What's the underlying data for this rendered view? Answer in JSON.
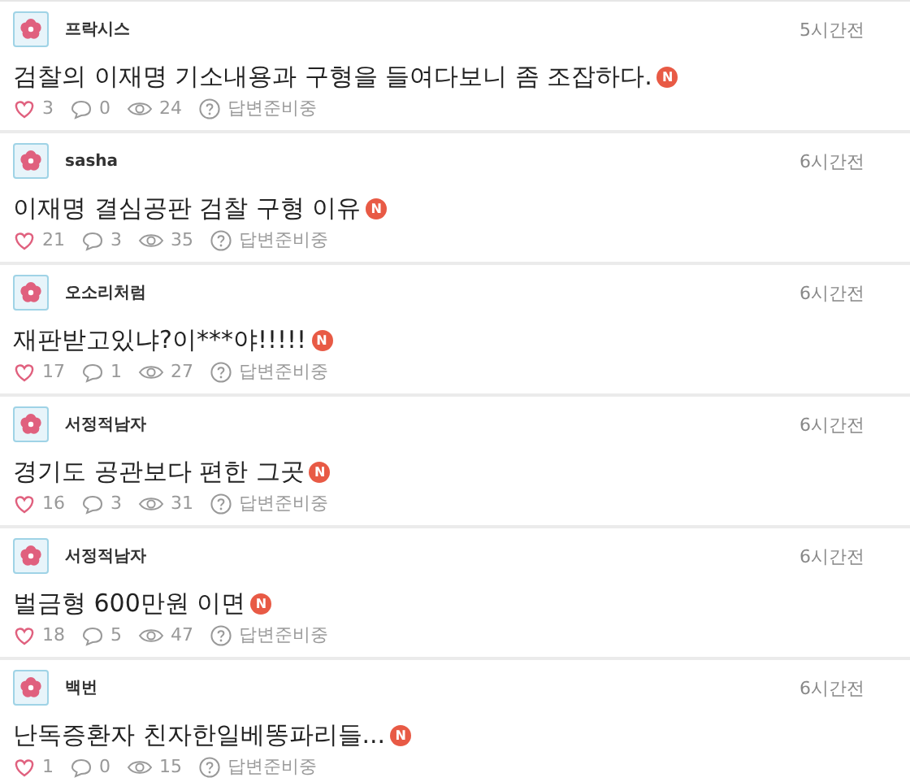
{
  "posts": [
    {
      "author": "프락시스",
      "time": "5시간전",
      "title": "검찰의 이재명 기소내용과 구형을 들여다보니 좀 조잡하다.",
      "badge": "N",
      "likes": "3",
      "comments": "0",
      "views": "24",
      "status": "답변준비중"
    },
    {
      "author": "sasha",
      "time": "6시간전",
      "title": "이재명 결심공판 검찰 구형 이유",
      "badge": "N",
      "likes": "21",
      "comments": "3",
      "views": "35",
      "status": "답변준비중"
    },
    {
      "author": "오소리처럼",
      "time": "6시간전",
      "title": "재판받고있냐?이***야!!!!!",
      "badge": "N",
      "likes": "17",
      "comments": "1",
      "views": "27",
      "status": "답변준비중"
    },
    {
      "author": "서정적남자",
      "time": "6시간전",
      "title": "경기도 공관보다 편한 그곳",
      "badge": "N",
      "likes": "16",
      "comments": "3",
      "views": "31",
      "status": "답변준비중"
    },
    {
      "author": "서정적남자",
      "time": "6시간전",
      "title": "벌금형 600만원 이면",
      "badge": "N",
      "likes": "18",
      "comments": "5",
      "views": "47",
      "status": "답변준비중"
    },
    {
      "author": "백번",
      "time": "6시간전",
      "title": "난독증환자 친자한일베똥파리들...",
      "badge": "N",
      "likes": "1",
      "comments": "0",
      "views": "15",
      "status": "답변준비중"
    }
  ]
}
